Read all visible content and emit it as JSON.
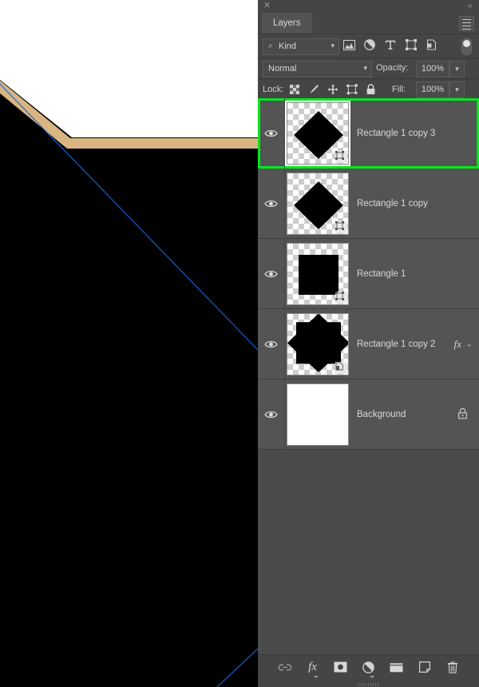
{
  "canvas": {
    "background_color": "#000000",
    "shape_fill": "#ffffff",
    "shape_border_color": "#d9b581",
    "guide_line_color": "#1565e0",
    "description": "Black canvas with a white octagon-corner shape outlined in tan, crossed by thin blue diagonal guide lines"
  },
  "panel": {
    "title_bar": {
      "close_icon": "close-icon",
      "collapse_icon": "double-chevron-left-icon"
    },
    "tab_label": "Layers",
    "menu_icon": "hamburger-menu-icon",
    "filter": {
      "search_icon": "search-icon",
      "kind_label": "Kind",
      "chevron": "⌄",
      "icons": [
        {
          "name": "filter-pixel-icon",
          "title": "Pixel layers"
        },
        {
          "name": "filter-adjustment-icon",
          "title": "Adjustment layers"
        },
        {
          "name": "filter-type-icon",
          "title": "Type layers"
        },
        {
          "name": "filter-shape-icon",
          "title": "Shape layers"
        },
        {
          "name": "filter-smart-object-icon",
          "title": "Smart objects"
        }
      ],
      "toggle_name": "filter-enable-toggle"
    },
    "blend": {
      "mode": "Normal",
      "chevron": "⌄",
      "opacity_label": "Opacity:",
      "opacity_value": "100%",
      "opacity_chevron": "⌄"
    },
    "lock": {
      "label": "Lock:",
      "icons": [
        {
          "name": "lock-transparent-pixels-icon"
        },
        {
          "name": "lock-image-pixels-icon"
        },
        {
          "name": "lock-position-icon"
        },
        {
          "name": "lock-artboard-nesting-icon"
        },
        {
          "name": "lock-all-icon"
        }
      ],
      "fill_label": "Fill:",
      "fill_value": "100%",
      "fill_chevron": "⌄"
    },
    "layers": [
      {
        "name": "Rectangle 1 copy 3",
        "visible": true,
        "selected": true,
        "thumb_shape": "diamond",
        "thumb_transparent": true,
        "badge": "vector-mask-badge",
        "has_fx": false,
        "locked": false
      },
      {
        "name": "Rectangle 1 copy",
        "visible": true,
        "selected": false,
        "thumb_shape": "diamond",
        "thumb_transparent": true,
        "badge": "vector-mask-badge",
        "has_fx": false,
        "locked": false
      },
      {
        "name": "Rectangle 1",
        "visible": true,
        "selected": false,
        "thumb_shape": "square",
        "thumb_transparent": true,
        "badge": "vector-mask-badge",
        "has_fx": false,
        "locked": false
      },
      {
        "name": "Rectangle 1 copy 2",
        "visible": true,
        "selected": false,
        "thumb_shape": "eight-point-star",
        "thumb_transparent": true,
        "badge": "smart-object-badge",
        "has_fx": true,
        "fx_label": "fx",
        "fx_chevron": "⌄",
        "locked": false
      },
      {
        "name": "Background",
        "visible": true,
        "selected": false,
        "thumb_shape": "none",
        "thumb_transparent": false,
        "badge": null,
        "has_fx": false,
        "locked": true,
        "lock_icon": "padlock-icon"
      }
    ],
    "bottom_toolbar": [
      {
        "name": "link-layers-button",
        "icon": "link-icon",
        "caret": false
      },
      {
        "name": "layer-style-button",
        "icon": "fx-icon",
        "caret": true
      },
      {
        "name": "add-layer-mask-button",
        "icon": "mask-icon",
        "caret": false
      },
      {
        "name": "new-adjustment-layer-button",
        "icon": "adjustment-icon",
        "caret": true
      },
      {
        "name": "new-group-button",
        "icon": "folder-icon",
        "caret": false
      },
      {
        "name": "new-layer-button",
        "icon": "new-layer-icon",
        "caret": false
      },
      {
        "name": "delete-layer-button",
        "icon": "trash-icon",
        "caret": false
      }
    ]
  },
  "colors": {
    "panel_bg": "#4b4b4b",
    "header_bg": "#454545",
    "row_bg": "#545454",
    "selection_green": "#00e819",
    "text": "#d9d9d9"
  }
}
